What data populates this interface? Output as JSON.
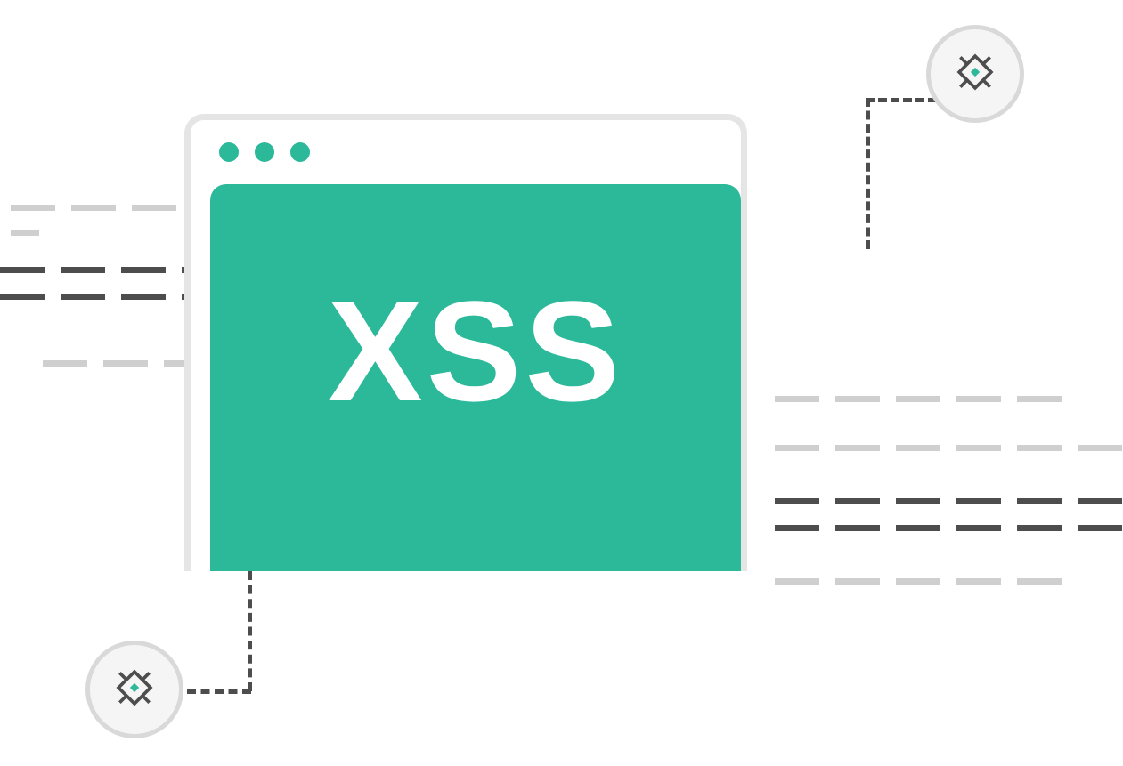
{
  "window": {
    "label": "XSS"
  },
  "colors": {
    "accent": "#2cb99a",
    "window_border": "#e5e5e5",
    "dash_dark": "#4d4d4d",
    "dash_light": "#cfcfcf",
    "badge_fill": "#f5f5f5",
    "badge_border": "#d9d9d9"
  },
  "icons": {
    "top_right": "bug-chip-icon",
    "bottom_left": "bug-chip-icon"
  }
}
